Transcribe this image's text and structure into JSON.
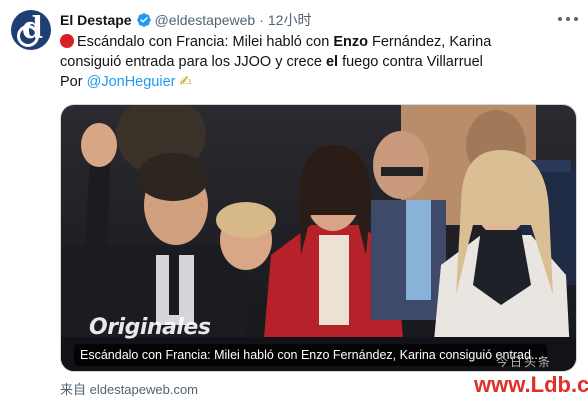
{
  "author": {
    "name": "El Destape",
    "handle": "@eldestapeweb",
    "separator": "·",
    "time": "12小时"
  },
  "tweet": {
    "line1_a": "Escándalo con Francia: Milei habló con ",
    "line1_bold": "Enzo",
    "line1_b": " Fernández, Karina",
    "line2_a": "consiguió entrada para los JJOO y crece ",
    "line2_bold": "el",
    "line2_b": " fuego contra Villarruel",
    "line3_a": "Por ",
    "line3_mention": "@JonHeguier",
    "line3_emoji": "✍"
  },
  "card": {
    "brand_overlay": "Originales",
    "caption": "Escándalo con Francia: Milei habló con Enzo Fernández, Karina consiguió entrad..."
  },
  "source": "来自 eldestapeweb.com",
  "watermark": {
    "text": "www.Ldb.cc",
    "sub": "今日头条"
  },
  "colors": {
    "link": "#1d9bf0",
    "verified": "#1d9bf0",
    "alert": "#d81f26",
    "muted": "#536471"
  },
  "icons": {
    "avatar": "el-destape-logo",
    "verified": "verified-badge-icon",
    "more": "more-options-icon",
    "alert": "red-circle-icon",
    "writing": "writing-hand-icon"
  }
}
